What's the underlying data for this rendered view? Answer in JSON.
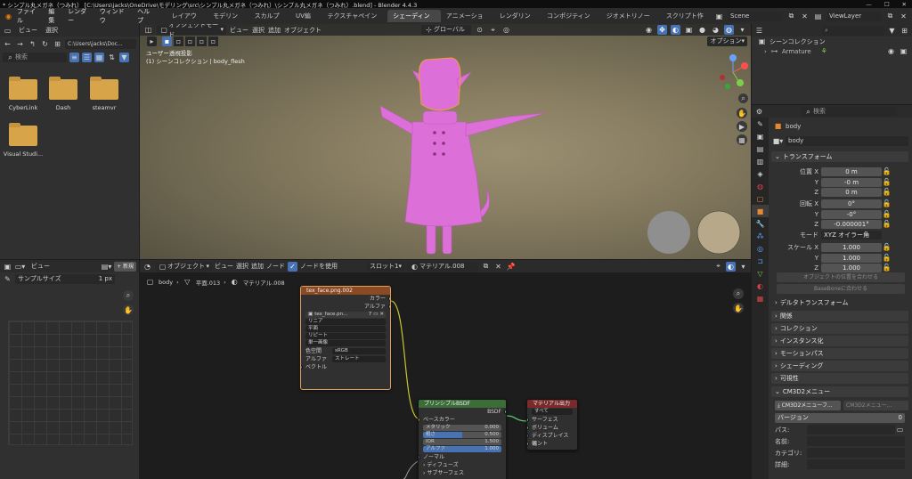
{
  "titlebar": {
    "title": "* シンプル丸メガネ（つみれ） [C:\\Users\\jacks\\OneDrive\\モデリング\\src\\シンプル丸メガネ（つみれ）\\シンプル丸メガネ（つみれ）.blend] - Blender 4.4.3",
    "minimize": "—",
    "maximize": "☐",
    "close": "✕"
  },
  "menu": [
    "ファイル",
    "編集",
    "レンダー",
    "ウィンドウ",
    "ヘルプ"
  ],
  "workspaces": [
    "レイアウト",
    "モデリング",
    "スカルプト",
    "UV編集",
    "テクスチャペイント",
    "シェーディング",
    "アニメーション",
    "レンダリング",
    "コンポジティング",
    "ジオメトリノード",
    "スクリプト作成"
  ],
  "active_workspace": "シェーディング",
  "scene": {
    "scene_name": "Scene",
    "view_layer": "ViewLayer"
  },
  "filebrowser": {
    "menu": [
      "ビュー",
      "選択"
    ],
    "path": "C:\\Users\\jacks\\Doc...",
    "search_placeholder": "検索",
    "folders": [
      "CyberLink",
      "Dash",
      "steamvr",
      "Visual Studi..."
    ]
  },
  "viewport": {
    "mode": "オブジェクトモード",
    "menu": [
      "ビュー",
      "選択",
      "追加",
      "オブジェクト"
    ],
    "orientation": "グローバル",
    "options": "オプション",
    "overlay_line1": "ユーザー透視投影",
    "overlay_line2": "(1) シーンコレクション | body_flesh"
  },
  "outliner": {
    "title": "シーンコレクション",
    "items": [
      "Armature"
    ]
  },
  "properties": {
    "search_placeholder": "検索",
    "object_name": "body",
    "data_name": "body",
    "transform_title": "トランスフォーム",
    "location": {
      "label": "位置 X",
      "y_label": "Y",
      "z_label": "Z",
      "x": "0 m",
      "y": "-0 m",
      "z": "0 m"
    },
    "rotation": {
      "label": "回転 X",
      "y_label": "Y",
      "z_label": "Z",
      "x": "0°",
      "y": "-0°",
      "z": "-0.000001°"
    },
    "mode": {
      "label": "モード",
      "value": "XYZ オイラー角"
    },
    "scale": {
      "label": "スケール X",
      "y_label": "Y",
      "z_label": "Z",
      "x": "1.000",
      "y": "1.000",
      "z": "1.000"
    },
    "btn_align_origin": "オブジェクトの位置を合わせる",
    "btn_align_basebone": "BaseBoneに合わせる",
    "delta_transform": "デルタトランスフォーム",
    "sections": [
      "関係",
      "コレクション",
      "インスタンス化",
      "モーションパス",
      "シェーディング",
      "可視性"
    ],
    "cm3d2": {
      "title": "CM3D2メニュー",
      "btn1": "CM3D2メニューフ...",
      "btn2": "CM3D2メニュー...",
      "version_label": "バージョン",
      "version_value": "0",
      "path_label": "パス:",
      "name_label": "名前:",
      "category_label": "カテゴリ:",
      "detail_label": "詳細:"
    }
  },
  "image_editor": {
    "menu": [
      "ビュー",
      "+ 新規"
    ],
    "sample_label": "サンプルサイズ",
    "sample_value": "1 px"
  },
  "node_editor": {
    "mode": "オブジェクト",
    "menu": [
      "ビュー",
      "選択",
      "追加",
      "ノード"
    ],
    "use_nodes": "ノードを使用",
    "slot": "スロット1",
    "material": "マテリアル.008",
    "breadcrumb": [
      "body",
      "平面.013",
      "マテリアル.008"
    ]
  },
  "nodes": {
    "tex": {
      "title": "tex_face.png.002",
      "out_color": "カラー",
      "out_alpha": "アルファ",
      "image": "tex_face.pn...",
      "users": "7",
      "interp": "リニア",
      "proj": "平面",
      "ext": "リピート",
      "source": "単一画像",
      "colorspace_label": "色空間",
      "colorspace": "sRGB",
      "alpha_label": "アルファ",
      "alpha": "ストレート",
      "vector": "ベクトル"
    },
    "bsdf": {
      "title": "プリンシプルBSDF",
      "out": "BSDF",
      "base_color": "ベースカラー",
      "metallic_label": "メタリック",
      "metallic": "0.000",
      "roughness_label": "粗さ",
      "roughness": "0.500",
      "ior_label": "IOR",
      "ior": "1.500",
      "alpha_label": "アルファ",
      "alpha": "1.000",
      "normal": "ノーマル",
      "diffuse": "ディフューズ",
      "subsurface": "サブサーフェス"
    },
    "output": {
      "title": "マテリアル出力",
      "target": "すべて",
      "surface": "サーフェス",
      "volume": "ボリューム",
      "displacement": "ディスプレイスメント",
      "thickness": "幅"
    }
  },
  "colors": {
    "accent": "#4772b3",
    "character": "#dd6fd8",
    "tex_header": "#8b4a21",
    "bsdf_header": "#3c6d39",
    "output_header": "#7a2a2a"
  }
}
